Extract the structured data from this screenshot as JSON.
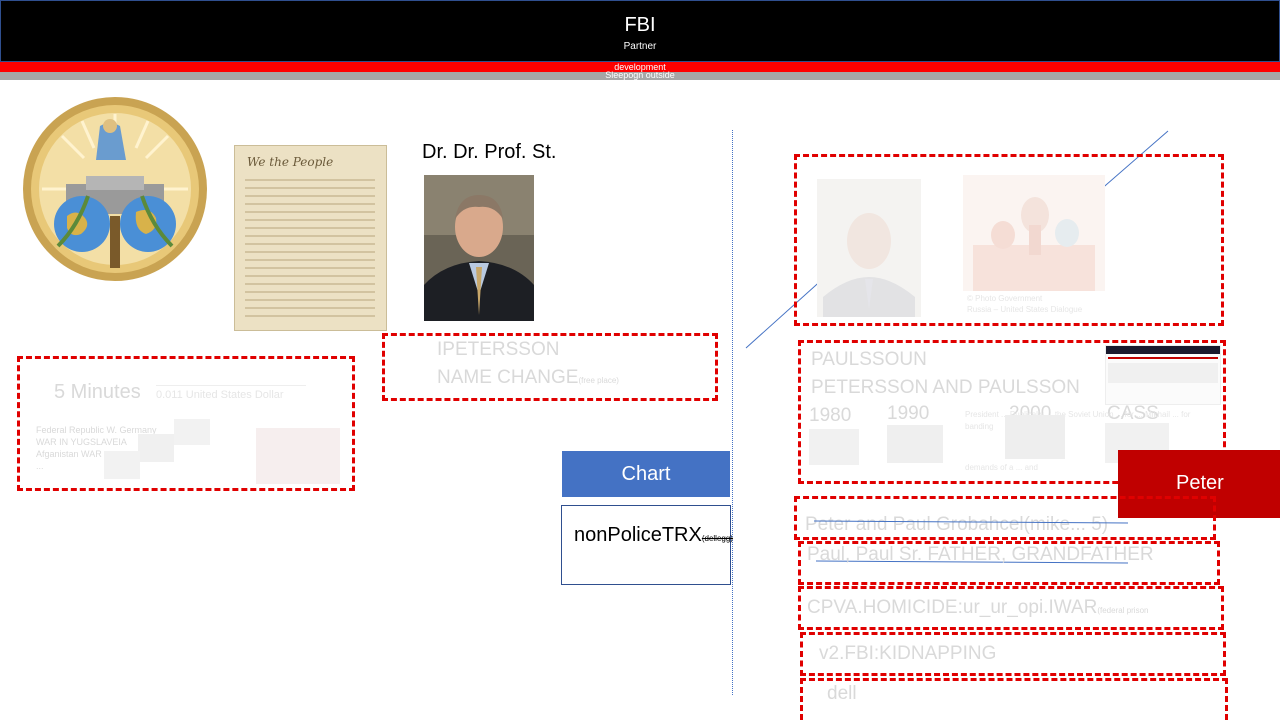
{
  "header": {
    "title": "FBI",
    "subtitle": "Partner",
    "ribbon_top": "development",
    "ribbon_bottom": "Sleepogn outside"
  },
  "profile": {
    "name": "Dr. Dr. Prof. St.",
    "alias_line1": "IPETERSSON",
    "alias_line2": "NAME CHANGE",
    "alias_note": "(free place)"
  },
  "left_card": {
    "heading": "5 Minutes",
    "currency": "0.011 United States Dollar",
    "line1": "Federal Republic W. Germany",
    "line2": "WAR IN YUGSLAVEIA",
    "line3": "Afganistan WAR",
    "line4": "..."
  },
  "buttons": {
    "chart": "Chart",
    "nonpolice": "nonPoliceTRX",
    "nonpolice_note": "(dellegg)",
    "peter": "Peter"
  },
  "right_panel": {
    "photo_caption_line1": "© Photo Government",
    "photo_caption_line2": "Russia – United States Dialogue",
    "family_line1": "PAULSSOUN",
    "family_line2": "PETERSSON AND PAULSSON",
    "year1": "1980",
    "year2": "1990",
    "year3": "2000",
    "year4": "CASS",
    "history_text": "President ... Publically ... the Soviet Union ... for ... Mikhail ... for banding",
    "history_text2": "demands of a ... and",
    "row1": "Peter and Paul Grobahcel(mike... 5)",
    "row2": "Paul, Paul Sr. FATHER, GRANDFATHER",
    "row3": "CPVA.HOMICIDE:ur_ur_opi.IWAR",
    "row3_note": "(federal prison",
    "row4": "v2.FBI:KIDNAPPING",
    "row5": "dell"
  }
}
